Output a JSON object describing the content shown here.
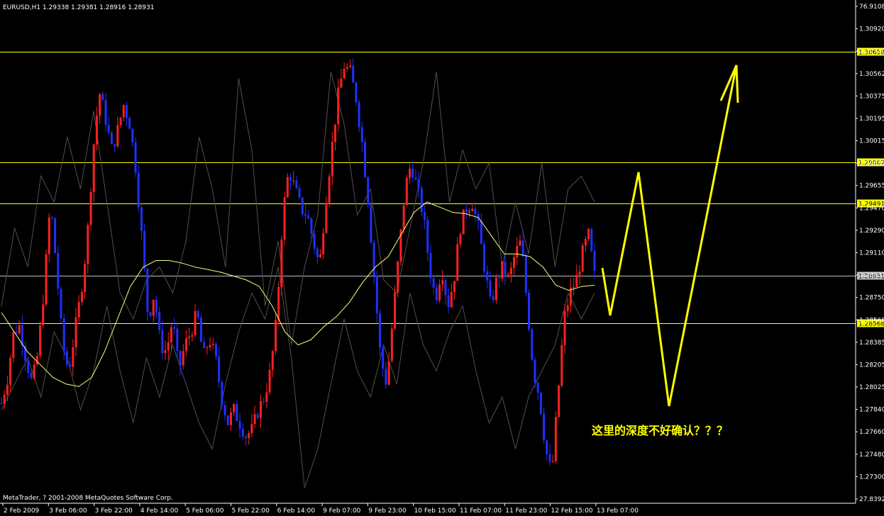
{
  "header": {
    "symbol_text": "EURUSD,H1  1.29338 1.29381 1.28916 1.28931"
  },
  "footer": {
    "copyright": "MetaTrader, ? 2001-2008 MetaQuotes Software Corp."
  },
  "annotation": {
    "text": "这里的深度不好确认？？？",
    "color": "#ffff00"
  },
  "colors": {
    "background": "#000000",
    "bull_candle": "#ff2020",
    "bear_candle": "#2030ff",
    "moving_average": "#ffff80",
    "level_line": "#ffff00",
    "current_price_line": "#c0c0c0",
    "axis": "#ffffff",
    "shadow_line": "#505050"
  },
  "chart_data": {
    "type": "candlestick",
    "symbol": "EURUSD",
    "timeframe": "H1",
    "ohlc_current": {
      "open": 1.29338,
      "high": 1.29381,
      "low": 1.28916,
      "close": 1.28931
    },
    "y_axis": {
      "ticks": [
        "76.9108",
        "1.30920",
        "1.30740",
        "1.30562",
        "1.30375",
        "1.30195",
        "1.30015",
        "1.29835",
        "1.29655",
        "1.29470",
        "1.29290",
        "1.29110",
        "1.28931",
        "1.28750",
        "1.28568",
        "1.28385",
        "1.28205",
        "1.28025",
        "1.27840",
        "1.27660",
        "1.27480",
        "1.27300",
        "27.8392"
      ],
      "ylim": [
        1.2721,
        1.3101
      ]
    },
    "x_axis": {
      "ticks": [
        "2 Feb 2009",
        "3 Feb 06:00",
        "3 Feb 22:00",
        "4 Feb 14:00",
        "5 Feb 06:00",
        "5 Feb 22:00",
        "6 Feb 14:00",
        "9 Feb 07:00",
        "9 Feb 23:00",
        "10 Feb 15:00",
        "11 Feb 07:00",
        "11 Feb 23:00",
        "12 Feb 15:00",
        "13 Feb 07:00"
      ]
    },
    "horizontal_levels": [
      {
        "price": 1.30658,
        "label": "1.30658",
        "style": "highlight"
      },
      {
        "price": 1.29807,
        "label": "1.29807",
        "style": "highlight"
      },
      {
        "price": 1.29491,
        "label": "1.29491",
        "style": "highlight"
      },
      {
        "price": 1.28931,
        "label": "1.28931",
        "style": "current"
      },
      {
        "price": 1.28568,
        "label": "1.28568",
        "style": "highlight"
      }
    ],
    "close_path": [
      1.2795,
      1.2815,
      1.285,
      1.2855,
      1.283,
      1.281,
      1.2835,
      1.2885,
      1.295,
      1.29,
      1.284,
      1.282,
      1.285,
      1.288,
      1.292,
      1.299,
      1.3035,
      1.3015,
      1.299,
      1.3005,
      1.3025,
      1.301,
      1.2975,
      1.292,
      1.286,
      1.288,
      1.284,
      1.2835,
      1.286,
      1.282,
      1.284,
      1.285,
      1.2865,
      1.283,
      1.2845,
      1.283,
      1.28,
      1.278,
      1.279,
      1.278,
      1.277,
      1.2775,
      1.279,
      1.28,
      1.282,
      1.286,
      1.294,
      1.2975,
      1.296,
      1.2945,
      1.294,
      1.292,
      1.29,
      1.295,
      1.299,
      1.303,
      1.3055,
      1.305,
      1.303,
      1.2995,
      1.295,
      1.289,
      1.283,
      1.281,
      1.286,
      1.291,
      1.296,
      1.298,
      1.296,
      1.294,
      1.29,
      1.2875,
      1.29,
      1.287,
      1.289,
      1.293,
      1.2945,
      1.295,
      1.293,
      1.29,
      1.287,
      1.289,
      1.29,
      1.289,
      1.291,
      1.292,
      1.287,
      1.282,
      1.28,
      1.276,
      1.274,
      1.28,
      1.286,
      1.288,
      1.289,
      1.291,
      1.2925,
      1.2893
    ],
    "ma_path": [
      1.2865,
      1.285,
      1.2835,
      1.2825,
      1.2815,
      1.281,
      1.2808,
      1.2815,
      1.2835,
      1.286,
      1.2885,
      1.29,
      1.2905,
      1.2905,
      1.2903,
      1.29,
      1.2898,
      1.2896,
      1.2893,
      1.289,
      1.2885,
      1.287,
      1.285,
      1.284,
      1.2844,
      1.2854,
      1.2862,
      1.2873,
      1.2888,
      1.29,
      1.2908,
      1.2925,
      1.2942,
      1.295,
      1.2946,
      1.2942,
      1.2941,
      1.2938,
      1.2924,
      1.291,
      1.291,
      1.2908,
      1.29,
      1.2886,
      1.2882,
      1.2885,
      1.2886
    ],
    "max_path": [
      1.287,
      1.293,
      1.29,
      1.297,
      1.295,
      1.3,
      1.296,
      1.302,
      1.295,
      1.288,
      1.286,
      1.289,
      1.29,
      1.288,
      1.292,
      1.3,
      1.296,
      1.29,
      1.3045,
      1.299,
      1.287,
      1.292,
      1.284,
      1.29,
      1.294,
      1.305,
      1.301,
      1.294,
      1.296,
      1.289,
      1.288,
      1.293,
      1.298,
      1.305,
      1.295,
      1.299,
      1.296,
      1.298,
      1.29,
      1.295,
      1.291,
      1.298,
      1.29,
      1.296,
      1.297,
      1.295
    ],
    "min_path": [
      1.279,
      1.281,
      1.283,
      1.28,
      1.285,
      1.283,
      1.279,
      1.282,
      1.287,
      1.282,
      1.278,
      1.283,
      1.28,
      1.284,
      1.281,
      1.278,
      1.276,
      1.281,
      1.285,
      1.288,
      1.286,
      1.29,
      1.283,
      1.273,
      1.276,
      1.281,
      1.286,
      1.282,
      1.28,
      1.284,
      1.281,
      1.288,
      1.284,
      1.282,
      1.285,
      1.287,
      1.282,
      1.278,
      1.28,
      1.276,
      1.28,
      1.282,
      1.284,
      1.288,
      1.286,
      1.288
    ]
  }
}
